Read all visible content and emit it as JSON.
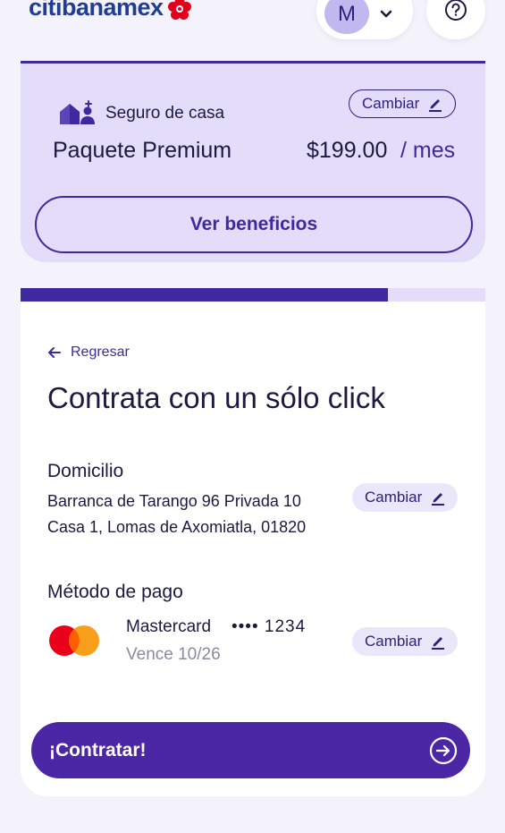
{
  "header": {
    "logo_text": "citibanamex",
    "avatar_initial": "M",
    "icons": {
      "chevron": "chevron-down-icon",
      "help": "question-circle-icon",
      "logo_mark": "flower-logo-icon"
    }
  },
  "plan": {
    "label": "Seguro de casa",
    "change_label": "Cambiar",
    "package_name": "Paquete Premium",
    "price": "$199.00",
    "period": "/ mes",
    "benefits_button": "Ver beneficios"
  },
  "progress": {
    "value": 0.79
  },
  "checkout": {
    "back_label": "Regresar",
    "title": "Contrata con un sólo click",
    "address": {
      "heading": "Domicilio",
      "line1": "Barranca de Tarango 96 Privada 10",
      "line2": "Casa 1, Lomas de Axomiatla, 01820",
      "change_label": "Cambiar"
    },
    "payment": {
      "heading": "Método de pago",
      "brand": "Mastercard",
      "masked_number": "•••• 1234",
      "expiry": "Vence  10/26",
      "change_label": "Cambiar"
    },
    "submit_label": "¡Contratar!"
  },
  "colors": {
    "primary": "#3e2a9e",
    "button": "#4b27a6",
    "plan_bg": "#e3ddfa",
    "page_bg": "#f4f3fb",
    "brand_blue": "#213d93",
    "brand_red": "#e3001b",
    "mastercard_red": "#eb001b",
    "mastercard_orange": "#f79e1b"
  }
}
